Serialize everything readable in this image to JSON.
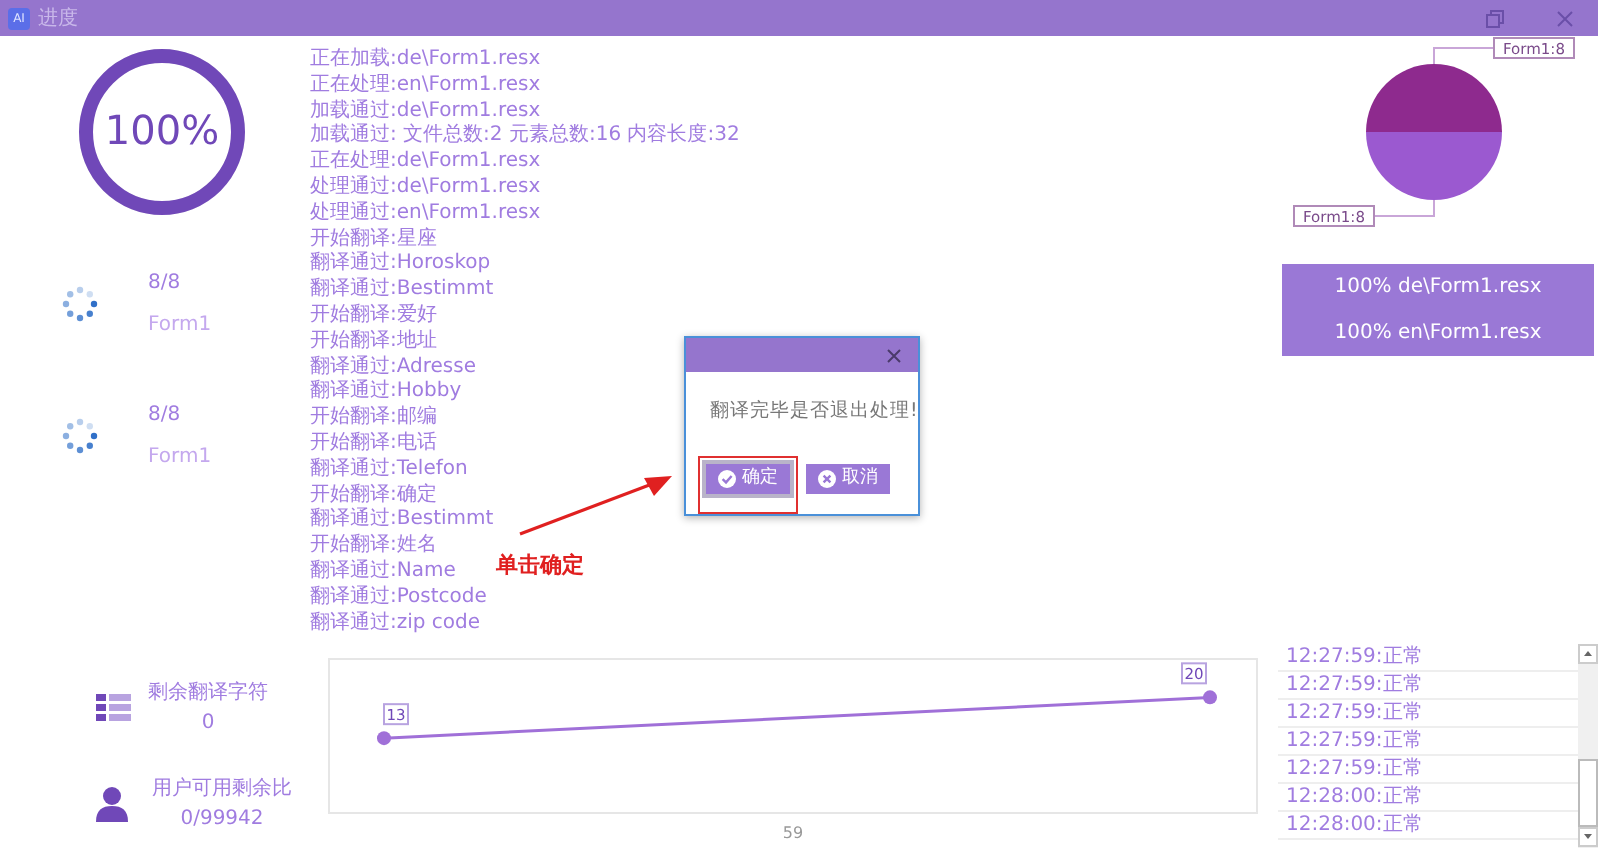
{
  "window": {
    "icon_text": "AI",
    "title": "进度"
  },
  "progress": {
    "level": 1,
    "label": "100%"
  },
  "tasks": [
    {
      "count": "8/8",
      "name": "Form1"
    },
    {
      "count": "8/8",
      "name": "Form1"
    }
  ],
  "log": [
    "正在加载:de\\Form1.resx",
    "正在处理:en\\Form1.resx",
    "加载通过:de\\Form1.resx",
    "加载通过: 文件总数:2 元素总数:16 内容长度:32",
    "正在处理:de\\Form1.resx",
    "处理通过:de\\Form1.resx",
    "处理通过:en\\Form1.resx",
    "开始翻译:星座",
    "翻译通过:Horoskop",
    "翻译通过:Bestimmt",
    "开始翻译:爱好",
    "开始翻译:地址",
    "翻译通过:Adresse",
    "翻译通过:Hobby",
    "开始翻译:邮编",
    "开始翻译:电话",
    "翻译通过:Telefon",
    "开始翻译:确定",
    "翻译通过:Bestimmt",
    "开始翻译:姓名",
    "翻译通过:Name",
    "翻译通过:Postcode",
    "翻译通过:zip code"
  ],
  "pie": {
    "chart_data": {
      "type": "pie",
      "categories": [
        "Form1:8",
        "Form1:8"
      ],
      "colors": [
        "#8e2a8e",
        "#9b59d0"
      ],
      "series": [
        {
          "values": [
            8,
            8
          ]
        }
      ]
    }
  },
  "file_progress": [
    "100% de\\Form1.resx",
    "100% en\\Form1.resx"
  ],
  "stats": [
    {
      "kind": "list",
      "label": "剩余翻译字符",
      "value": "0"
    },
    {
      "kind": "user",
      "label": "用户可用剩余比",
      "value": "0/99942"
    }
  ],
  "line_chart": {
    "chart_data": {
      "type": "line",
      "xlabel": "59",
      "series": [
        {
          "color": "#a070d8",
          "marker": true,
          "values": [
            13,
            20
          ]
        }
      ],
      "data_labels": true
    }
  },
  "status_log": [
    "12:27:59:正常",
    "12:27:59:正常",
    "12:27:59:正常",
    "12:27:59:正常",
    "12:27:59:正常",
    "12:28:00:正常",
    "12:28:00:正常"
  ],
  "dialog": {
    "message": "翻译完毕是否退出处理!",
    "buttons": [
      {
        "kind": "ok",
        "label": "确定",
        "selected": true
      },
      {
        "kind": "cancel",
        "label": "取消",
        "selected": false
      }
    ]
  },
  "annotation": {
    "text": "单击确定"
  }
}
